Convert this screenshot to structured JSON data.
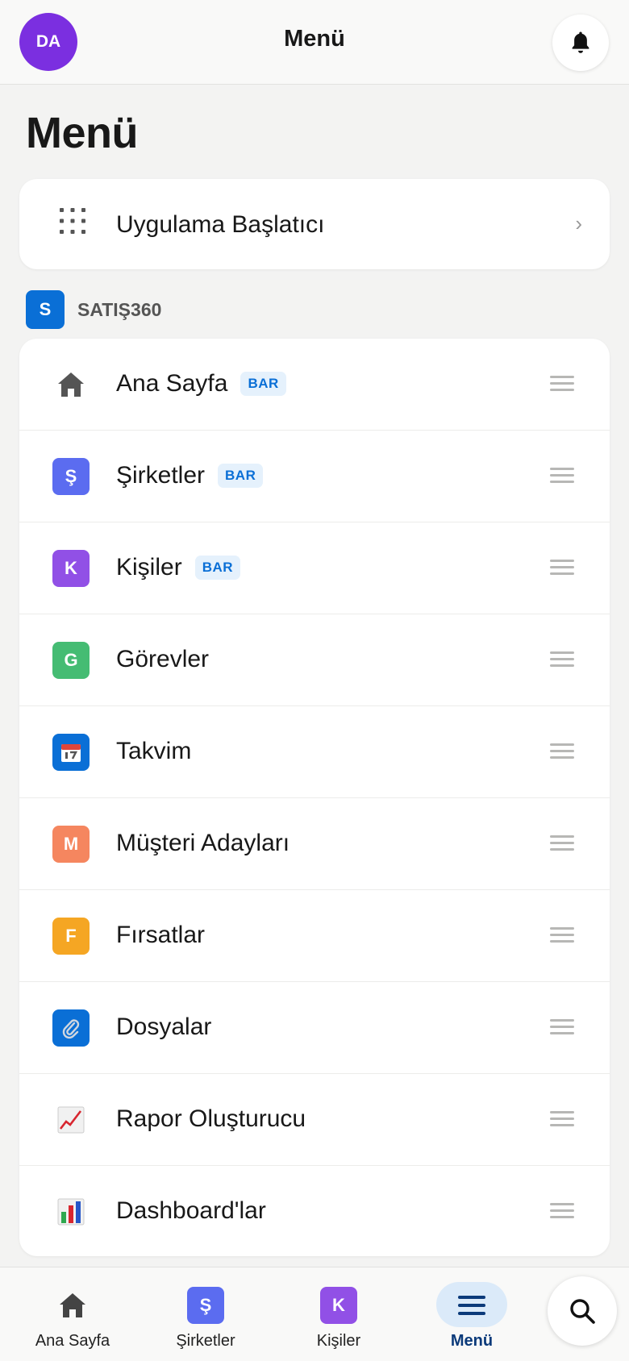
{
  "header": {
    "avatar_initials": "DA",
    "title": "Menü",
    "bell_icon": "bell-icon"
  },
  "page_title": "Menü",
  "launcher": {
    "label": "Uygulama Başlatıcı",
    "icon": "grid-icon",
    "chevron": "›"
  },
  "section": {
    "badge": "S",
    "title": "SATIŞ360",
    "badge_color": "#0a6fd6"
  },
  "items": [
    {
      "label": "Ana Sayfa",
      "tag": "BAR",
      "icon": "home-icon",
      "letter": "",
      "color": ""
    },
    {
      "label": "Şirketler",
      "tag": "BAR",
      "icon": "letter-icon",
      "letter": "Ş",
      "color": "#5b6cf0"
    },
    {
      "label": "Kişiler",
      "tag": "BAR",
      "icon": "letter-icon",
      "letter": "K",
      "color": "#9150e6"
    },
    {
      "label": "Görevler",
      "tag": "",
      "icon": "letter-icon",
      "letter": "G",
      "color": "#45bc73"
    },
    {
      "label": "Takvim",
      "tag": "",
      "icon": "calendar-icon",
      "letter": "",
      "color": "#0a6fd6"
    },
    {
      "label": "Müşteri Adayları",
      "tag": "",
      "icon": "letter-icon",
      "letter": "M",
      "color": "#f5865f"
    },
    {
      "label": "Fırsatlar",
      "tag": "",
      "icon": "letter-icon",
      "letter": "F",
      "color": "#f5a623"
    },
    {
      "label": "Dosyalar",
      "tag": "",
      "icon": "paperclip-icon",
      "letter": "",
      "color": "#0a6fd6"
    },
    {
      "label": "Rapor Oluşturucu",
      "tag": "",
      "icon": "line-chart-icon",
      "letter": "",
      "color": ""
    },
    {
      "label": "Dashboard'lar",
      "tag": "",
      "icon": "bar-chart-icon",
      "letter": "",
      "color": ""
    }
  ],
  "bottom_nav": [
    {
      "label": "Ana Sayfa",
      "icon": "home-icon",
      "letter": "",
      "color": ""
    },
    {
      "label": "Şirketler",
      "icon": "letter-icon",
      "letter": "Ş",
      "color": "#5b6cf0"
    },
    {
      "label": "Kişiler",
      "icon": "letter-icon",
      "letter": "K",
      "color": "#9150e6"
    },
    {
      "label": "Menü",
      "icon": "menu-icon",
      "letter": "",
      "color": "",
      "active": true
    }
  ],
  "search_icon": "search-icon"
}
